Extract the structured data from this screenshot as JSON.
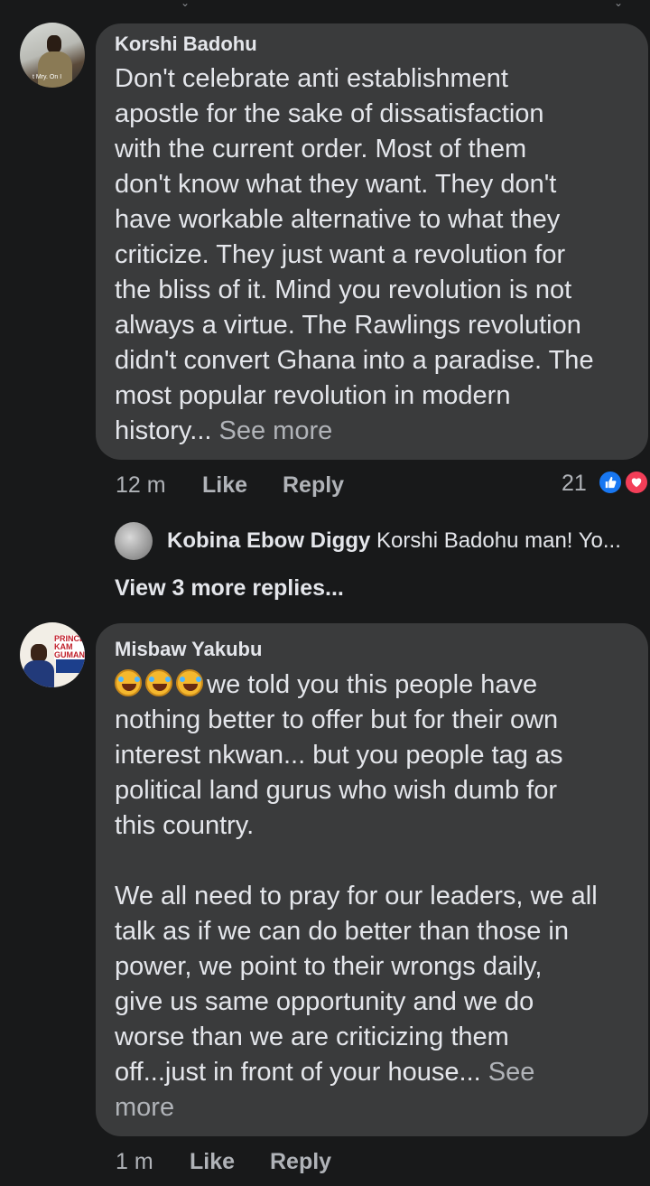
{
  "comments": [
    {
      "author": "Korshi Badohu",
      "text": "Don't celebrate anti establishment\napostle for the sake of dissatisfaction\nwith the current order. Most of them\ndon't know what they want. They don't\nhave workable alternative to what they\ncriticize. They just want a revolution for\nthe bliss of it. Mind you revolution is not\nalways a virtue. The Rawlings revolution\ndidn't convert Ghana into a paradise. The\nmost popular revolution in modern\nhistory...",
      "see_more": "See more",
      "time": "12 m",
      "like": "Like",
      "reply": "Reply",
      "reaction_count": "21",
      "reactions": [
        "like-reaction",
        "love-reaction"
      ],
      "avatar_caption": "t Mry. On I",
      "preview_reply": {
        "author": "Kobina Ebow Diggy",
        "text": "Korshi Badohu man! Yo..."
      },
      "view_more": "View 3 more replies..."
    },
    {
      "author": "Misbaw Yakubu",
      "emojis": [
        "rolling-on-floor-laughing-emoji",
        "rolling-on-floor-laughing-emoji",
        "rolling-on-floor-laughing-emoji"
      ],
      "text_after_emoji": " we told you this people have\nnothing better to offer but for their own\ninterest nkwan... but you people tag as\npolitical land gurus who wish dumb for\nthis country.\n\nWe all need to pray for our leaders, we all\ntalk as if we can do better than those in\npower, we point to their wrongs daily,\ngive us same opportunity and we do\nworse than we are criticizing them\noff...just in front of your house...",
      "see_more": "See\nmore",
      "time": "1 m",
      "like": "Like",
      "reply": "Reply",
      "avatar_caption": "PRINCE\nKAM\nGUMAN"
    }
  ],
  "colors": {
    "background": "#18191a",
    "bubble": "#3a3b3c",
    "text": "#e4e6eb",
    "secondary": "#b0b3b8",
    "like_blue": "#1877f2",
    "love_red": "#f33e58"
  }
}
